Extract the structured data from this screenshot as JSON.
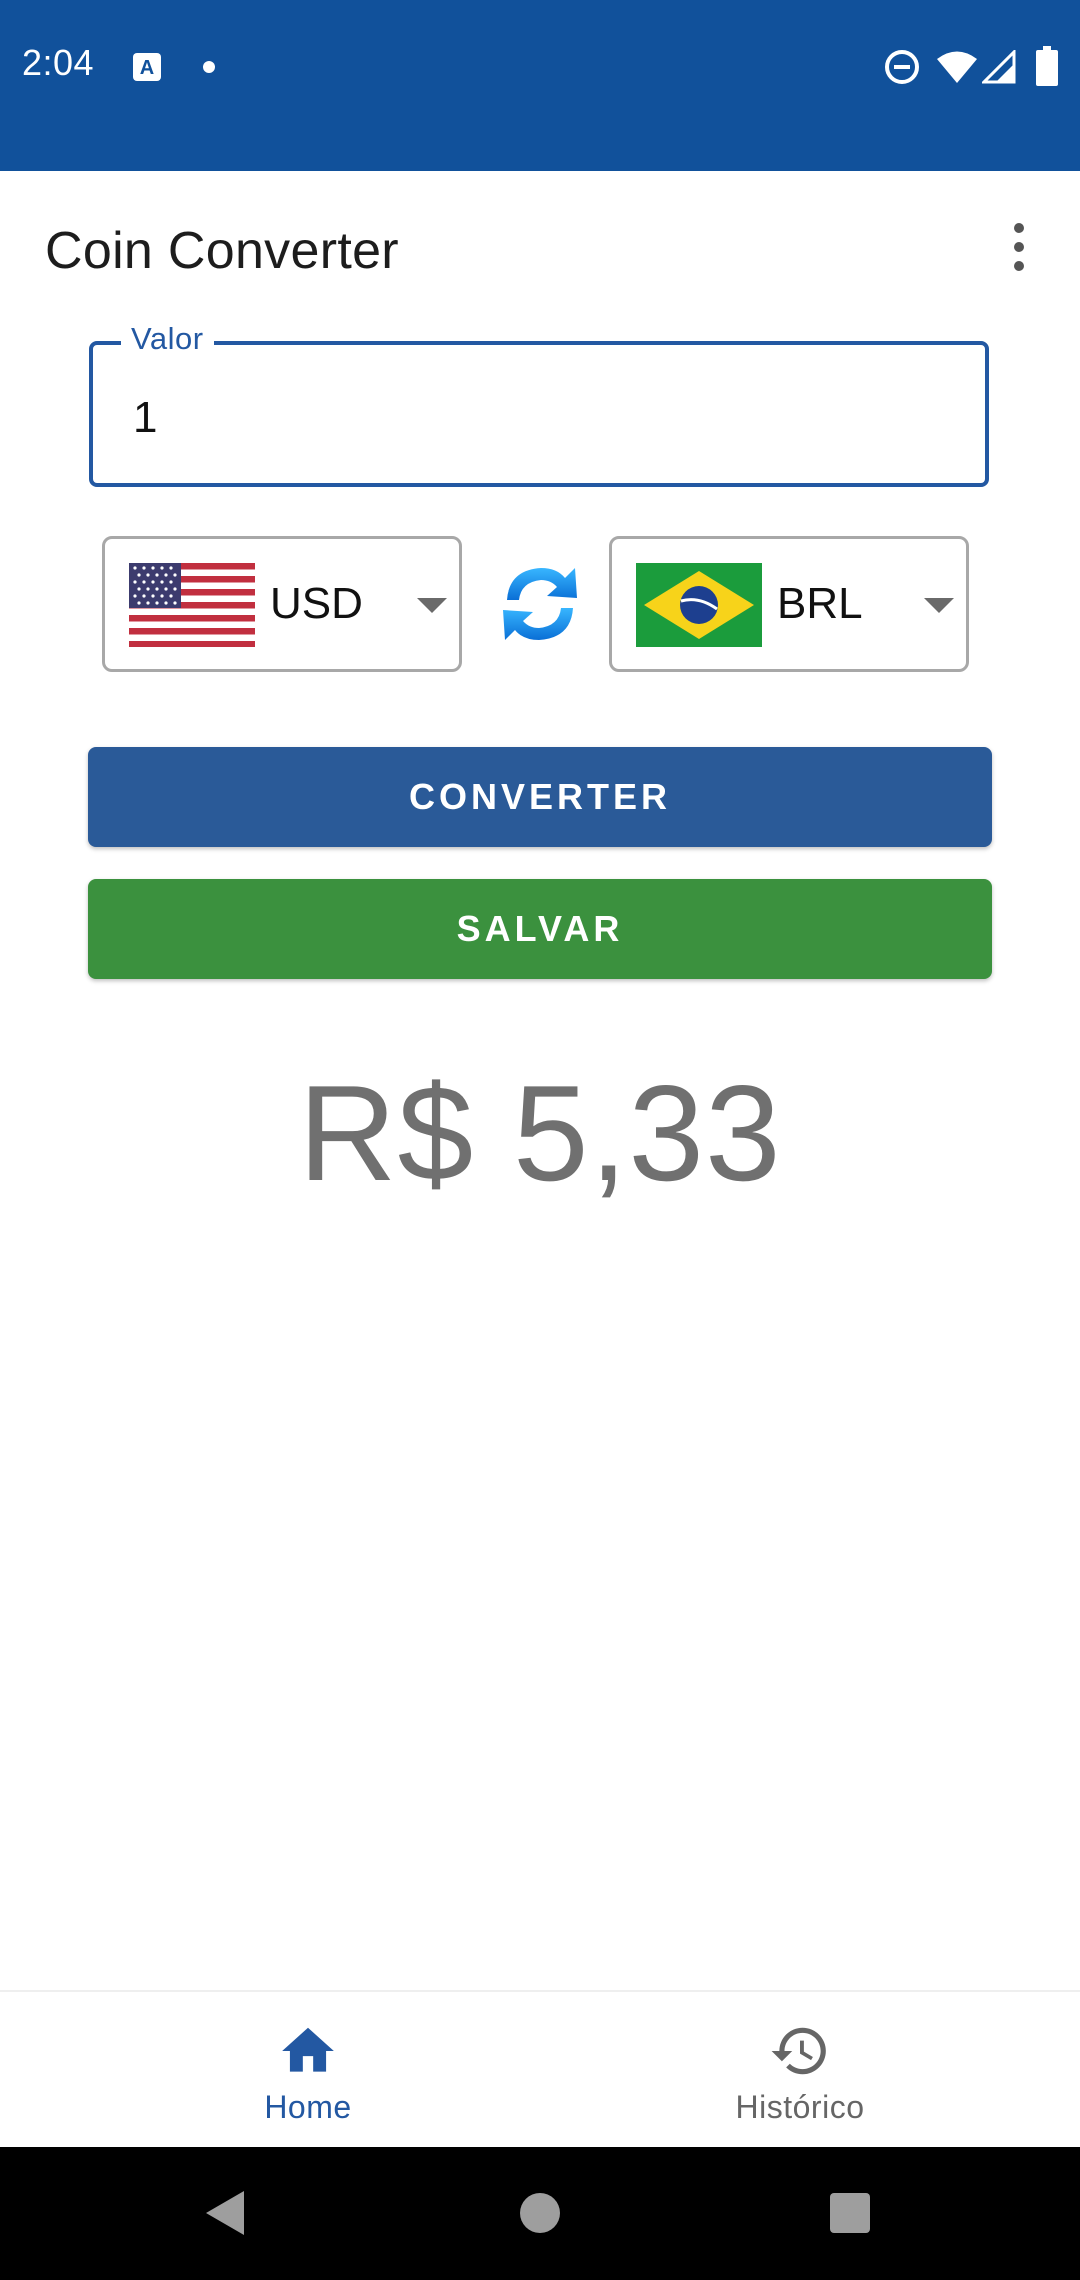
{
  "status_bar": {
    "time": "2:04",
    "icons": [
      "text-a-icon",
      "notification-dot-icon",
      "do-not-disturb-icon",
      "wifi-icon",
      "signal-icon",
      "battery-icon"
    ]
  },
  "app_bar": {
    "title": "Coin Converter",
    "menu_icon": "more-vert-icon"
  },
  "form": {
    "value_label": "Valor",
    "value_input": "1",
    "from_currency": {
      "code": "USD",
      "flag": "us-flag-icon"
    },
    "to_currency": {
      "code": "BRL",
      "flag": "brazil-flag-icon"
    },
    "swap_icon": "swap-arrows-icon"
  },
  "buttons": {
    "convert_label": "CONVERTER",
    "save_label": "SALVAR"
  },
  "result": {
    "text": "R$ 5,33"
  },
  "bottom_nav": {
    "items": [
      {
        "label": "Home",
        "icon": "home-icon",
        "selected": true
      },
      {
        "label": "Histórico",
        "icon": "history-icon",
        "selected": false
      }
    ]
  },
  "colors": {
    "primary": "#11519b",
    "button_convert": "#2a5a98",
    "button_save": "#3b913e",
    "result_text": "#707070"
  }
}
